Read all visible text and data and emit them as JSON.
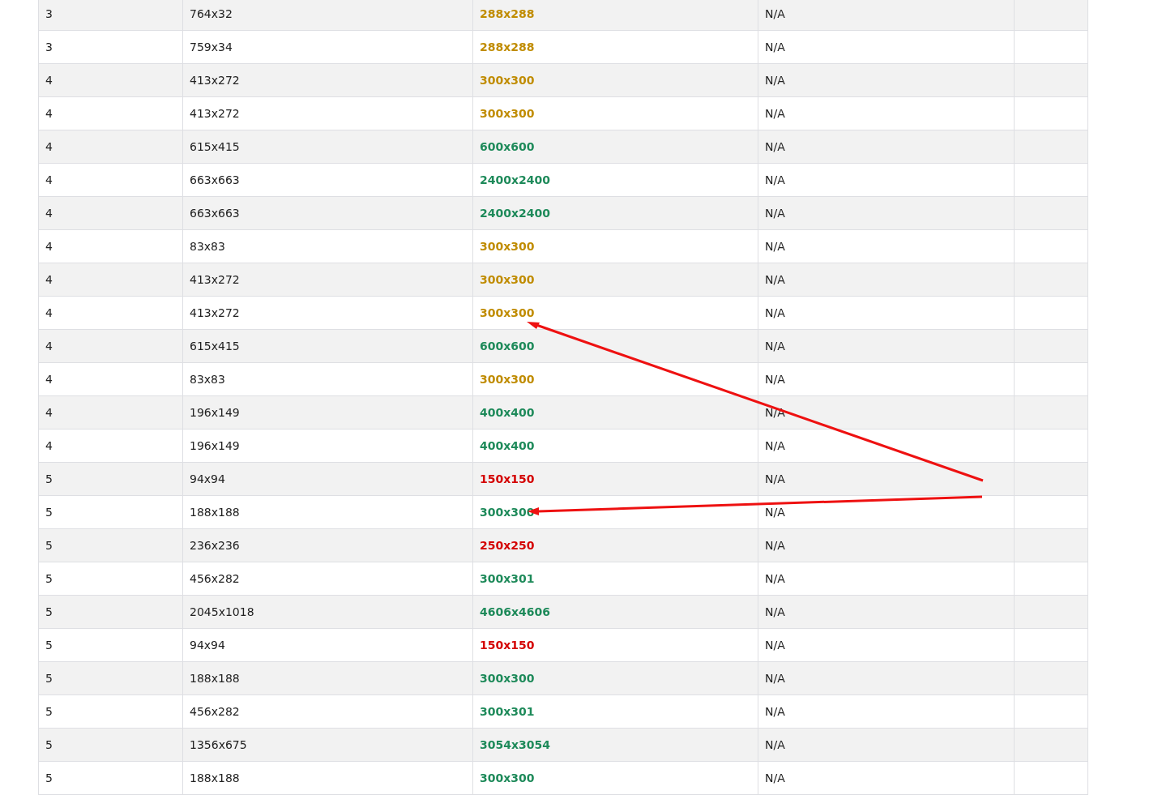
{
  "table": {
    "rows": [
      {
        "column_1": "3",
        "column_2": "764x32",
        "column_3": {
          "text": "288x288",
          "color": "#c08c00"
        },
        "column_4": "N/A"
      },
      {
        "column_1": "3",
        "column_2": "759x34",
        "column_3": {
          "text": "288x288",
          "color": "#c08c00"
        },
        "column_4": "N/A"
      },
      {
        "column_1": "4",
        "column_2": "413x272",
        "column_3": {
          "text": "300x300",
          "color": "#c08c00"
        },
        "column_4": "N/A"
      },
      {
        "column_1": "4",
        "column_2": "413x272",
        "column_3": {
          "text": "300x300",
          "color": "#c08c00"
        },
        "column_4": "N/A"
      },
      {
        "column_1": "4",
        "column_2": "615x415",
        "column_3": {
          "text": "600x600",
          "color": "#1e8a5a"
        },
        "column_4": "N/A"
      },
      {
        "column_1": "4",
        "column_2": "663x663",
        "column_3": {
          "text": "2400x2400",
          "color": "#1e8a5a"
        },
        "column_4": "N/A"
      },
      {
        "column_1": "4",
        "column_2": "663x663",
        "column_3": {
          "text": "2400x2400",
          "color": "#1e8a5a"
        },
        "column_4": "N/A"
      },
      {
        "column_1": "4",
        "column_2": "83x83",
        "column_3": {
          "text": "300x300",
          "color": "#c08c00"
        },
        "column_4": "N/A"
      },
      {
        "column_1": "4",
        "column_2": "413x272",
        "column_3": {
          "text": "300x300",
          "color": "#c08c00"
        },
        "column_4": "N/A"
      },
      {
        "column_1": "4",
        "column_2": "413x272",
        "column_3": {
          "text": "300x300",
          "color": "#c08c00"
        },
        "column_4": "N/A"
      },
      {
        "column_1": "4",
        "column_2": "615x415",
        "column_3": {
          "text": "600x600",
          "color": "#1e8a5a"
        },
        "column_4": "N/A"
      },
      {
        "column_1": "4",
        "column_2": "83x83",
        "column_3": {
          "text": "300x300",
          "color": "#c08c00"
        },
        "column_4": "N/A"
      },
      {
        "column_1": "4",
        "column_2": "196x149",
        "column_3": {
          "text": "400x400",
          "color": "#1e8a5a"
        },
        "column_4": "N/A"
      },
      {
        "column_1": "4",
        "column_2": "196x149",
        "column_3": {
          "text": "400x400",
          "color": "#1e8a5a"
        },
        "column_4": "N/A"
      },
      {
        "column_1": "5",
        "column_2": "94x94",
        "column_3": {
          "text": "150x150",
          "color": "#d40000"
        },
        "column_4": "N/A"
      },
      {
        "column_1": "5",
        "column_2": "188x188",
        "column_3": {
          "text": "300x300",
          "color": "#1e8a5a"
        },
        "column_4": "N/A"
      },
      {
        "column_1": "5",
        "column_2": "236x236",
        "column_3": {
          "text": "250x250",
          "color": "#d40000"
        },
        "column_4": "N/A"
      },
      {
        "column_1": "5",
        "column_2": "456x282",
        "column_3": {
          "text": "300x301",
          "color": "#1e8a5a"
        },
        "column_4": "N/A"
      },
      {
        "column_1": "5",
        "column_2": "2045x1018",
        "column_3": {
          "text": "4606x4606",
          "color": "#1e8a5a"
        },
        "column_4": "N/A"
      },
      {
        "column_1": "5",
        "column_2": "94x94",
        "column_3": {
          "text": "150x150",
          "color": "#d40000"
        },
        "column_4": "N/A"
      },
      {
        "column_1": "5",
        "column_2": "188x188",
        "column_3": {
          "text": "300x300",
          "color": "#1e8a5a"
        },
        "column_4": "N/A"
      },
      {
        "column_1": "5",
        "column_2": "456x282",
        "column_3": {
          "text": "300x301",
          "color": "#1e8a5a"
        },
        "column_4": "N/A"
      },
      {
        "column_1": "5",
        "column_2": "1356x675",
        "column_3": {
          "text": "3054x3054",
          "color": "#1e8a5a"
        },
        "column_4": "N/A"
      },
      {
        "column_1": "5",
        "column_2": "188x188",
        "column_3": {
          "text": "300x300",
          "color": "#1e8a5a"
        },
        "column_4": "N/A"
      }
    ]
  }
}
